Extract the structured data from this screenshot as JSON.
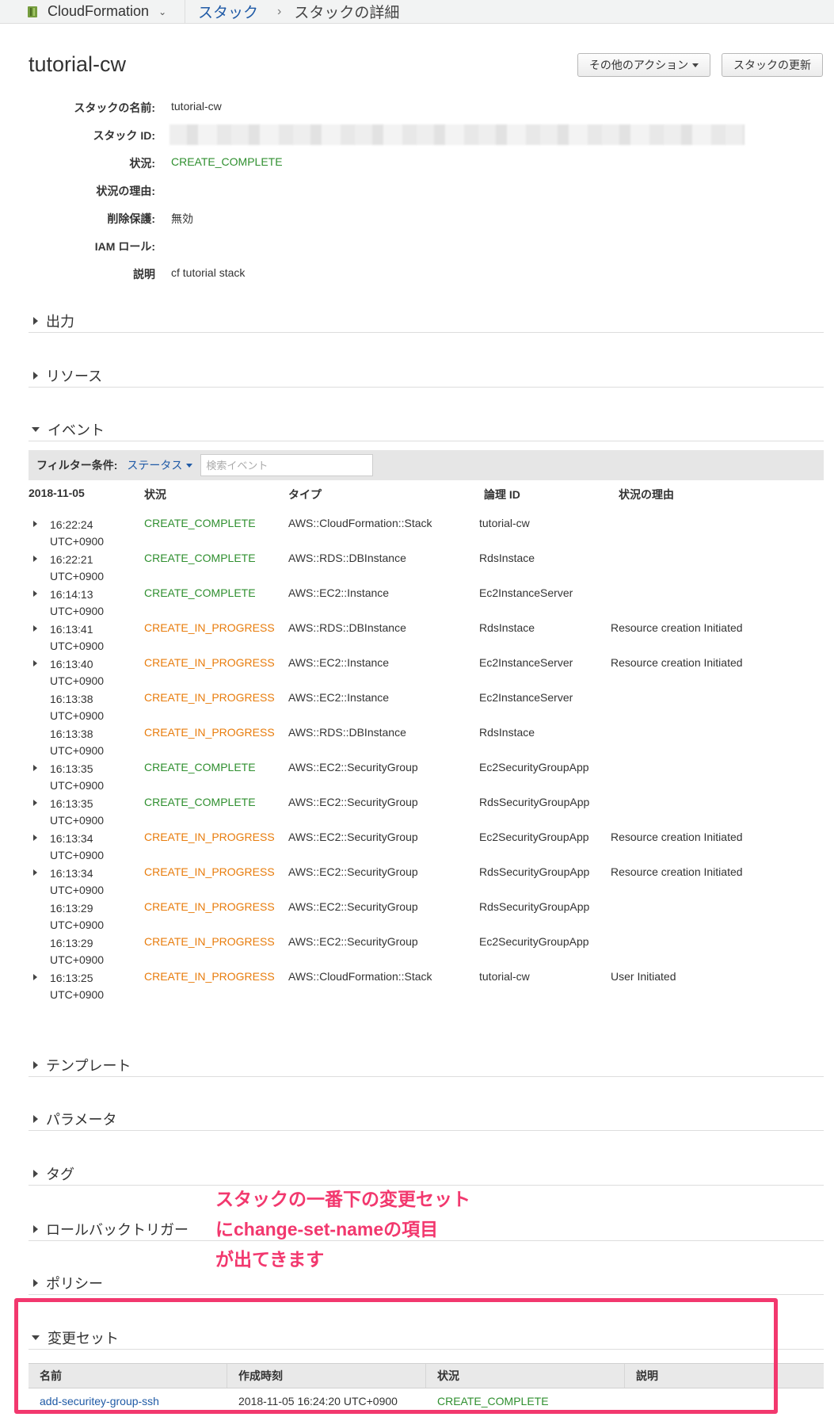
{
  "nav": {
    "service": "CloudFormation",
    "crumb_stacks": "スタック",
    "crumb_sep": "›",
    "crumb_current": "スタックの詳細"
  },
  "header": {
    "title": "tutorial-cw",
    "other_actions_label": "その他のアクション",
    "update_stack_label": "スタックの更新"
  },
  "details": {
    "stack_name_label": "スタックの名前:",
    "stack_name": "tutorial-cw",
    "stack_id_label": "スタック ID:",
    "status_label": "状況:",
    "status": "CREATE_COMPLETE",
    "status_reason_label": "状況の理由:",
    "termination_protection_label": "削除保護:",
    "termination_protection": "無効",
    "iam_role_label": "IAM ロール:",
    "description_label": "説明",
    "description": "cf tutorial stack"
  },
  "sections": {
    "outputs": "出力",
    "resources": "リソース",
    "events": "イベント",
    "template": "テンプレート",
    "parameters": "パラメータ",
    "tags": "タグ",
    "rollback_triggers": "ロールバックトリガー",
    "policy": "ポリシー",
    "change_sets": "変更セット"
  },
  "events": {
    "filter_label": "フィルター条件:",
    "filter_dropdown": "ステータス",
    "search_placeholder": "検索イベント",
    "columns": [
      "2018-11-05",
      "状況",
      "タイプ",
      "論理 ID",
      "状況の理由"
    ],
    "rows": [
      {
        "time": "16:22:24 UTC+0900",
        "status": "CREATE_COMPLETE",
        "type": "AWS::CloudFormation::Stack",
        "logical_id": "tutorial-cw",
        "reason": "",
        "expandable": true
      },
      {
        "time": "16:22:21 UTC+0900",
        "status": "CREATE_COMPLETE",
        "type": "AWS::RDS::DBInstance",
        "logical_id": "RdsInstace",
        "reason": "",
        "expandable": true
      },
      {
        "time": "16:14:13 UTC+0900",
        "status": "CREATE_COMPLETE",
        "type": "AWS::EC2::Instance",
        "logical_id": "Ec2InstanceServer",
        "reason": "",
        "expandable": true
      },
      {
        "time": "16:13:41 UTC+0900",
        "status": "CREATE_IN_PROGRESS",
        "type": "AWS::RDS::DBInstance",
        "logical_id": "RdsInstace",
        "reason": "Resource creation Initiated",
        "expandable": true
      },
      {
        "time": "16:13:40 UTC+0900",
        "status": "CREATE_IN_PROGRESS",
        "type": "AWS::EC2::Instance",
        "logical_id": "Ec2InstanceServer",
        "reason": "Resource creation Initiated",
        "expandable": true
      },
      {
        "time": "16:13:38 UTC+0900",
        "status": "CREATE_IN_PROGRESS",
        "type": "AWS::EC2::Instance",
        "logical_id": "Ec2InstanceServer",
        "reason": "",
        "expandable": false
      },
      {
        "time": "16:13:38 UTC+0900",
        "status": "CREATE_IN_PROGRESS",
        "type": "AWS::RDS::DBInstance",
        "logical_id": "RdsInstace",
        "reason": "",
        "expandable": false
      },
      {
        "time": "16:13:35 UTC+0900",
        "status": "CREATE_COMPLETE",
        "type": "AWS::EC2::SecurityGroup",
        "logical_id": "Ec2SecurityGroupApp",
        "reason": "",
        "expandable": true
      },
      {
        "time": "16:13:35 UTC+0900",
        "status": "CREATE_COMPLETE",
        "type": "AWS::EC2::SecurityGroup",
        "logical_id": "RdsSecurityGroupApp",
        "reason": "",
        "expandable": true
      },
      {
        "time": "16:13:34 UTC+0900",
        "status": "CREATE_IN_PROGRESS",
        "type": "AWS::EC2::SecurityGroup",
        "logical_id": "Ec2SecurityGroupApp",
        "reason": "Resource creation Initiated",
        "expandable": true
      },
      {
        "time": "16:13:34 UTC+0900",
        "status": "CREATE_IN_PROGRESS",
        "type": "AWS::EC2::SecurityGroup",
        "logical_id": "RdsSecurityGroupApp",
        "reason": "Resource creation Initiated",
        "expandable": true
      },
      {
        "time": "16:13:29 UTC+0900",
        "status": "CREATE_IN_PROGRESS",
        "type": "AWS::EC2::SecurityGroup",
        "logical_id": "RdsSecurityGroupApp",
        "reason": "",
        "expandable": false
      },
      {
        "time": "16:13:29 UTC+0900",
        "status": "CREATE_IN_PROGRESS",
        "type": "AWS::EC2::SecurityGroup",
        "logical_id": "Ec2SecurityGroupApp",
        "reason": "",
        "expandable": false
      },
      {
        "time": "16:13:25 UTC+0900",
        "status": "CREATE_IN_PROGRESS",
        "type": "AWS::CloudFormation::Stack",
        "logical_id": "tutorial-cw",
        "reason": "User Initiated",
        "expandable": true
      }
    ]
  },
  "annotation": {
    "line1": "スタックの一番下の変更セット",
    "line2": "にchange-set-nameの項目",
    "line3": "が出てきます"
  },
  "change_sets": {
    "columns": [
      "名前",
      "作成時刻",
      "状況",
      "説明"
    ],
    "rows": [
      {
        "name": "add-securitey-group-ssh",
        "created": "2018-11-05 16:24:20 UTC+0900",
        "status": "CREATE_COMPLETE",
        "description": ""
      }
    ]
  },
  "colors": {
    "complete": "#2f8f2f",
    "in_progress": "#e87c0c",
    "link": "#1f5aa6",
    "annotation": "#f2386e"
  }
}
